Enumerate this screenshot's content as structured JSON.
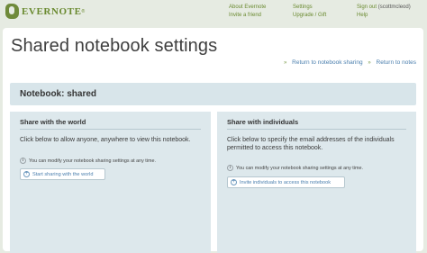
{
  "header": {
    "logo_text": "EVERNOTE",
    "logo_tm": "®",
    "nav_col1": [
      "About Evernote",
      "Invite a friend"
    ],
    "nav_col2": [
      "Settings",
      "Upgrade / Gift"
    ],
    "signout_label": "Sign out",
    "username": "(scottmcleod)",
    "help_label": "Help"
  },
  "page": {
    "title": "Shared notebook settings",
    "back_to_sharing": "Return to notebook sharing",
    "back_to_notes": "Return to notes",
    "notebook_label": "Notebook: shared"
  },
  "world": {
    "heading": "Share with the world",
    "description": "Click below to allow anyone, anywhere to view this notebook.",
    "note": "You can modify your notebook sharing settings at any time.",
    "button_label": "Start sharing with the world"
  },
  "individuals": {
    "heading": "Share with individuals",
    "description": "Click below to specify the email addresses of the individuals permitted to access this notebook.",
    "note": "You can modify your notebook sharing settings at any time.",
    "button_label": "Invite individuals to access this notebook"
  },
  "colors": {
    "accent_green": "#6a8a30",
    "link_blue": "#4b7fae",
    "panel_blue": "#dde8ec"
  },
  "icons": [
    "evernote-logo-icon",
    "info-icon",
    "plus-icon"
  ]
}
